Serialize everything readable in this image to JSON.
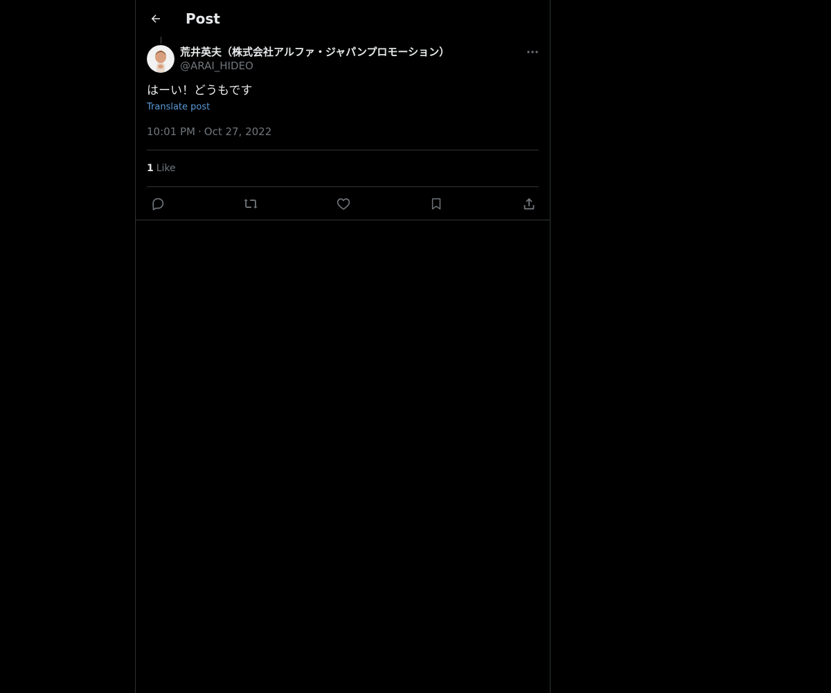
{
  "header": {
    "back_icon": "arrow-left-icon",
    "title": "Post"
  },
  "post": {
    "author": {
      "display_name": "荒井英夫（株式会社アルファ・ジャパンプロモーション）",
      "handle": "@ARAI_HIDEO",
      "avatar_icon": "avatar-photo"
    },
    "text": "はーい！どうもです",
    "translate_label": "Translate post",
    "time": "10:01 PM",
    "separator": "·",
    "date": "Oct 27, 2022",
    "likes_count": "1",
    "likes_label": "Like",
    "more_icon": "more-horizontal-icon"
  },
  "actions": [
    {
      "name": "reply",
      "icon": "reply-icon"
    },
    {
      "name": "repost",
      "icon": "repost-icon"
    },
    {
      "name": "like",
      "icon": "heart-icon"
    },
    {
      "name": "bookmark",
      "icon": "bookmark-icon"
    },
    {
      "name": "share",
      "icon": "share-icon"
    }
  ],
  "colors": {
    "background": "#000000",
    "text_primary": "#e7e9ea",
    "text_secondary": "#71767b",
    "link": "#5b9bd9",
    "border": "#2f3336"
  }
}
